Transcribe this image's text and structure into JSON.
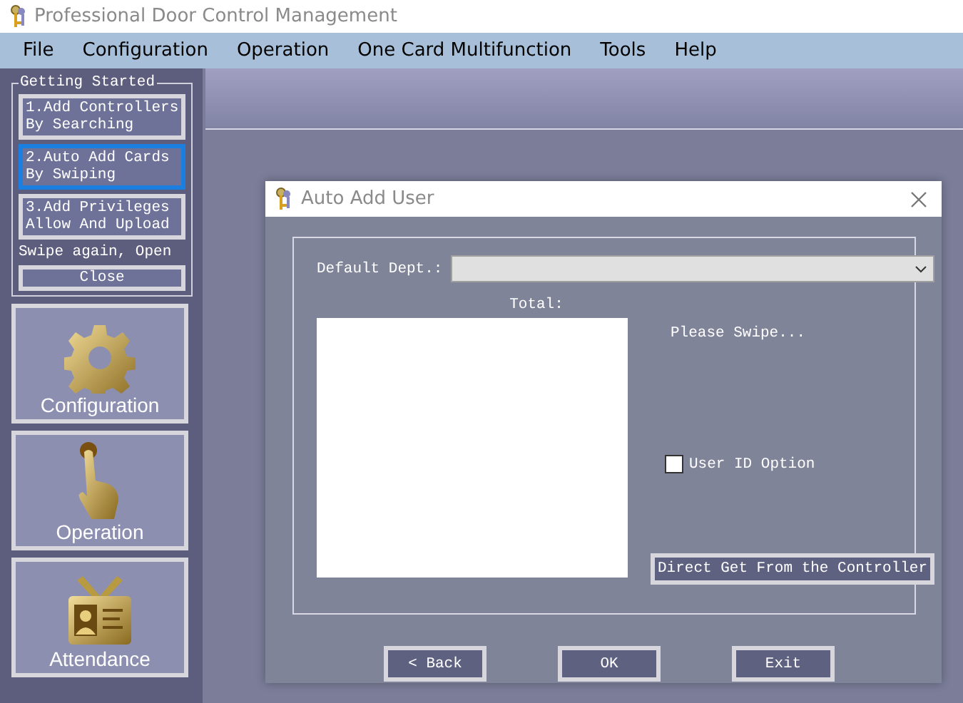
{
  "window": {
    "title": "Professional Door Control Management"
  },
  "menu": [
    "File",
    "Configuration",
    "Operation",
    "One Card Multifunction",
    "Tools",
    "Help"
  ],
  "getting_started": {
    "title": "Getting Started",
    "steps": [
      {
        "label": "1.Add Controllers\nBy Searching",
        "selected": false
      },
      {
        "label": "2.Auto Add Cards\nBy Swiping",
        "selected": true
      },
      {
        "label": "3.Add Privileges\nAllow And Upload",
        "selected": false
      }
    ],
    "note": "Swipe again, Open",
    "close": "Close"
  },
  "modules": [
    {
      "kind": "gear",
      "label": "Configuration"
    },
    {
      "kind": "hand",
      "label": "Operation"
    },
    {
      "kind": "badge",
      "label": "Attendance"
    }
  ],
  "dialog": {
    "title": "Auto Add User",
    "dept_label": "Default Dept.:",
    "total_label": "Total:",
    "status": "Please Swipe...",
    "user_id_option": {
      "label": "User ID Option",
      "checked": false
    },
    "direct_get": "Direct Get From the Controller",
    "buttons": [
      "< Back",
      "OK",
      "Exit"
    ]
  }
}
